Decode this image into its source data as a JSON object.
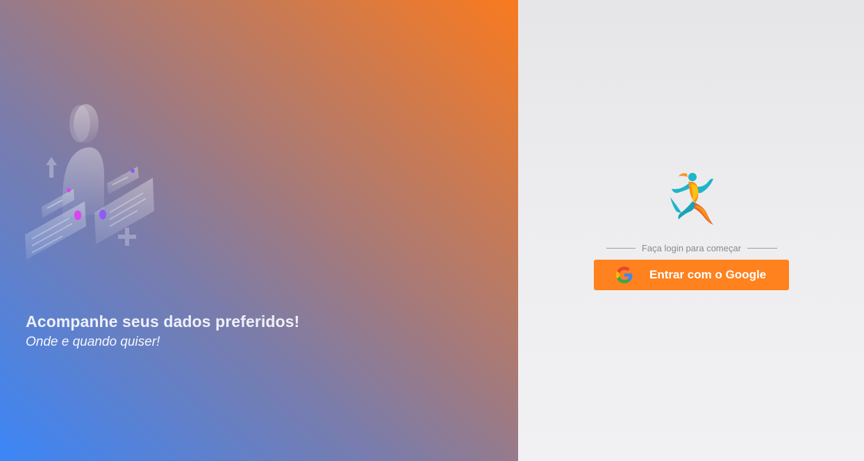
{
  "hero": {
    "title": "Acompanhe seus dados preferidos!",
    "subtitle": "Onde e quando quiser!",
    "illustration": "person-with-chat-bubbles-illustration",
    "gradient_colors": [
      "#3b86f7",
      "#7b7caa",
      "#a77a78",
      "#f97a1f"
    ]
  },
  "auth": {
    "logo": "running-person-logo",
    "divider_text": "Faça login para começar",
    "google_button_label": "Entrar com o Google",
    "google_icon": "google-g-icon",
    "button_color": "#ff821f",
    "panel_color": "#ebebed"
  }
}
